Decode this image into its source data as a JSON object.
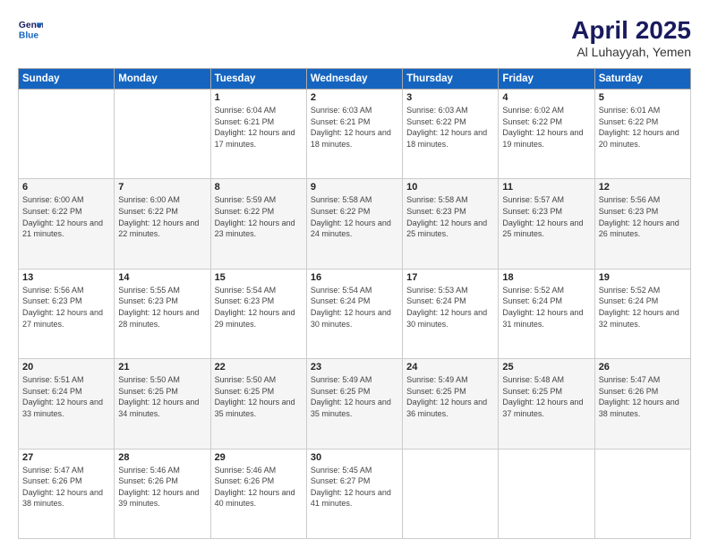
{
  "header": {
    "logo_line1": "General",
    "logo_line2": "Blue",
    "title": "April 2025",
    "subtitle": "Al Luhayyah, Yemen"
  },
  "days_of_week": [
    "Sunday",
    "Monday",
    "Tuesday",
    "Wednesday",
    "Thursday",
    "Friday",
    "Saturday"
  ],
  "weeks": [
    [
      {
        "day": "",
        "info": ""
      },
      {
        "day": "",
        "info": ""
      },
      {
        "day": "1",
        "info": "Sunrise: 6:04 AM\nSunset: 6:21 PM\nDaylight: 12 hours and 17 minutes."
      },
      {
        "day": "2",
        "info": "Sunrise: 6:03 AM\nSunset: 6:21 PM\nDaylight: 12 hours and 18 minutes."
      },
      {
        "day": "3",
        "info": "Sunrise: 6:03 AM\nSunset: 6:22 PM\nDaylight: 12 hours and 18 minutes."
      },
      {
        "day": "4",
        "info": "Sunrise: 6:02 AM\nSunset: 6:22 PM\nDaylight: 12 hours and 19 minutes."
      },
      {
        "day": "5",
        "info": "Sunrise: 6:01 AM\nSunset: 6:22 PM\nDaylight: 12 hours and 20 minutes."
      }
    ],
    [
      {
        "day": "6",
        "info": "Sunrise: 6:00 AM\nSunset: 6:22 PM\nDaylight: 12 hours and 21 minutes."
      },
      {
        "day": "7",
        "info": "Sunrise: 6:00 AM\nSunset: 6:22 PM\nDaylight: 12 hours and 22 minutes."
      },
      {
        "day": "8",
        "info": "Sunrise: 5:59 AM\nSunset: 6:22 PM\nDaylight: 12 hours and 23 minutes."
      },
      {
        "day": "9",
        "info": "Sunrise: 5:58 AM\nSunset: 6:22 PM\nDaylight: 12 hours and 24 minutes."
      },
      {
        "day": "10",
        "info": "Sunrise: 5:58 AM\nSunset: 6:23 PM\nDaylight: 12 hours and 25 minutes."
      },
      {
        "day": "11",
        "info": "Sunrise: 5:57 AM\nSunset: 6:23 PM\nDaylight: 12 hours and 25 minutes."
      },
      {
        "day": "12",
        "info": "Sunrise: 5:56 AM\nSunset: 6:23 PM\nDaylight: 12 hours and 26 minutes."
      }
    ],
    [
      {
        "day": "13",
        "info": "Sunrise: 5:56 AM\nSunset: 6:23 PM\nDaylight: 12 hours and 27 minutes."
      },
      {
        "day": "14",
        "info": "Sunrise: 5:55 AM\nSunset: 6:23 PM\nDaylight: 12 hours and 28 minutes."
      },
      {
        "day": "15",
        "info": "Sunrise: 5:54 AM\nSunset: 6:23 PM\nDaylight: 12 hours and 29 minutes."
      },
      {
        "day": "16",
        "info": "Sunrise: 5:54 AM\nSunset: 6:24 PM\nDaylight: 12 hours and 30 minutes."
      },
      {
        "day": "17",
        "info": "Sunrise: 5:53 AM\nSunset: 6:24 PM\nDaylight: 12 hours and 30 minutes."
      },
      {
        "day": "18",
        "info": "Sunrise: 5:52 AM\nSunset: 6:24 PM\nDaylight: 12 hours and 31 minutes."
      },
      {
        "day": "19",
        "info": "Sunrise: 5:52 AM\nSunset: 6:24 PM\nDaylight: 12 hours and 32 minutes."
      }
    ],
    [
      {
        "day": "20",
        "info": "Sunrise: 5:51 AM\nSunset: 6:24 PM\nDaylight: 12 hours and 33 minutes."
      },
      {
        "day": "21",
        "info": "Sunrise: 5:50 AM\nSunset: 6:25 PM\nDaylight: 12 hours and 34 minutes."
      },
      {
        "day": "22",
        "info": "Sunrise: 5:50 AM\nSunset: 6:25 PM\nDaylight: 12 hours and 35 minutes."
      },
      {
        "day": "23",
        "info": "Sunrise: 5:49 AM\nSunset: 6:25 PM\nDaylight: 12 hours and 35 minutes."
      },
      {
        "day": "24",
        "info": "Sunrise: 5:49 AM\nSunset: 6:25 PM\nDaylight: 12 hours and 36 minutes."
      },
      {
        "day": "25",
        "info": "Sunrise: 5:48 AM\nSunset: 6:25 PM\nDaylight: 12 hours and 37 minutes."
      },
      {
        "day": "26",
        "info": "Sunrise: 5:47 AM\nSunset: 6:26 PM\nDaylight: 12 hours and 38 minutes."
      }
    ],
    [
      {
        "day": "27",
        "info": "Sunrise: 5:47 AM\nSunset: 6:26 PM\nDaylight: 12 hours and 38 minutes."
      },
      {
        "day": "28",
        "info": "Sunrise: 5:46 AM\nSunset: 6:26 PM\nDaylight: 12 hours and 39 minutes."
      },
      {
        "day": "29",
        "info": "Sunrise: 5:46 AM\nSunset: 6:26 PM\nDaylight: 12 hours and 40 minutes."
      },
      {
        "day": "30",
        "info": "Sunrise: 5:45 AM\nSunset: 6:27 PM\nDaylight: 12 hours and 41 minutes."
      },
      {
        "day": "",
        "info": ""
      },
      {
        "day": "",
        "info": ""
      },
      {
        "day": "",
        "info": ""
      }
    ]
  ]
}
